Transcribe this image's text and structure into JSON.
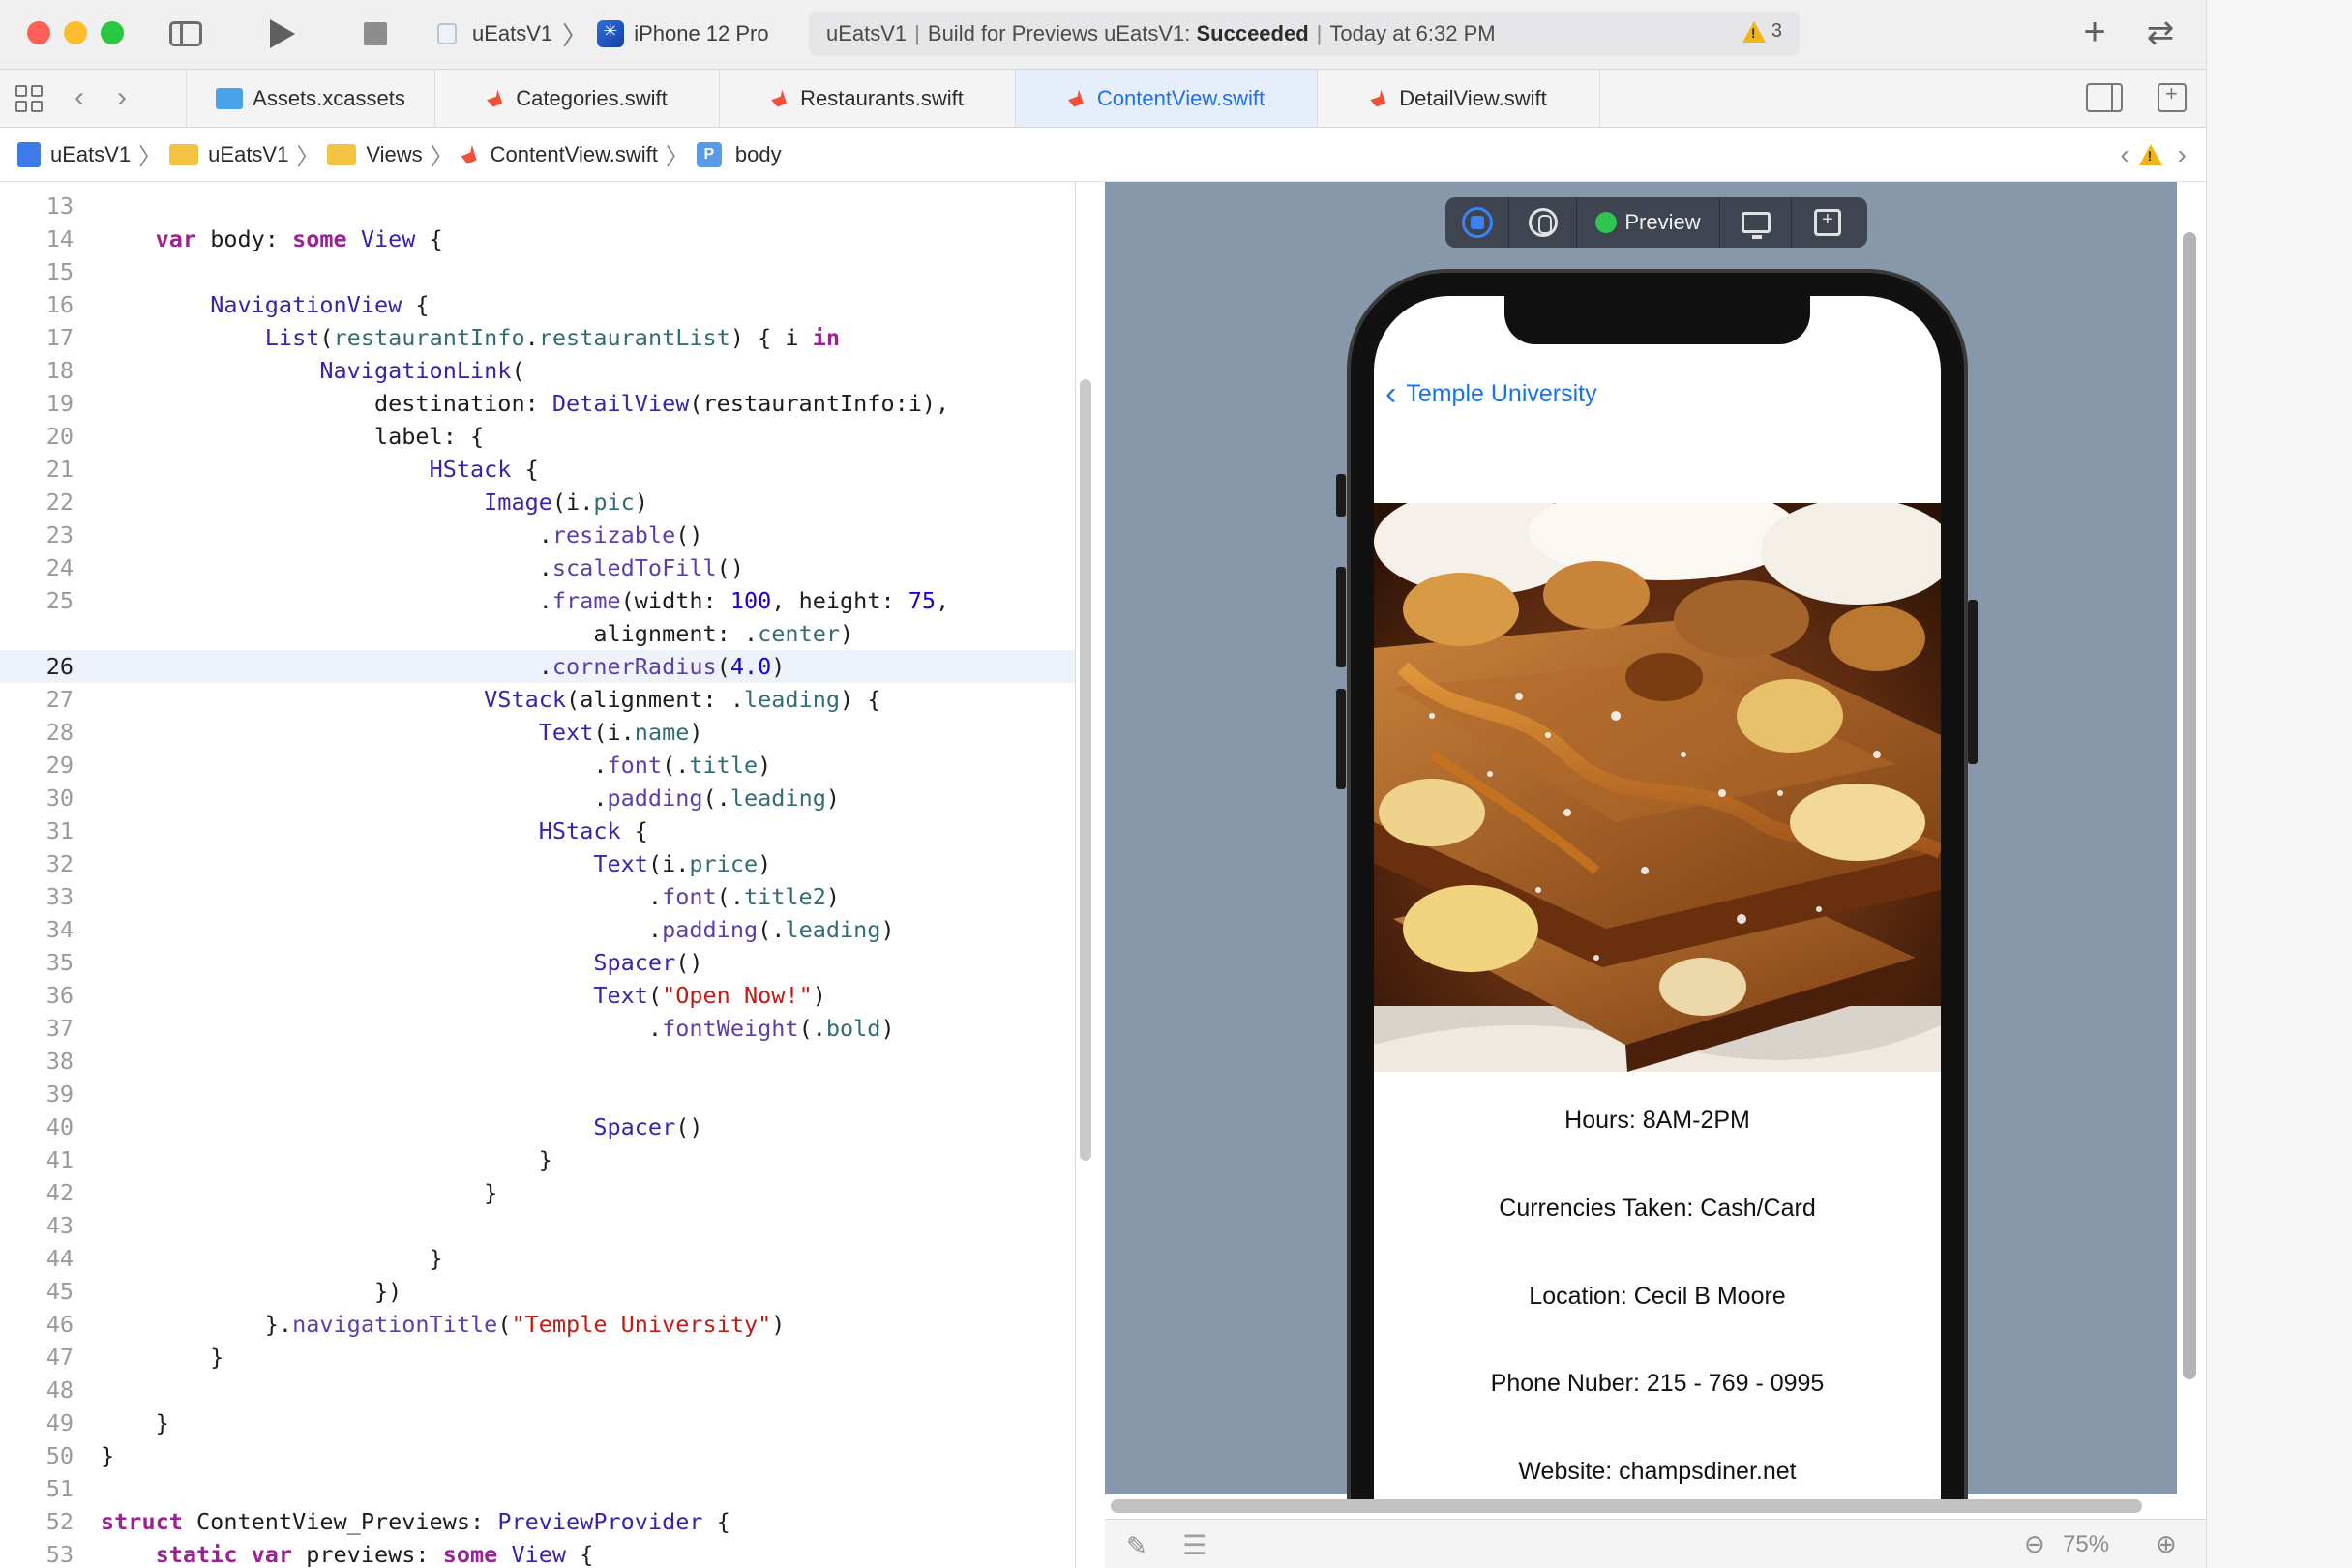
{
  "toolbar": {
    "scheme_name": "uEatsV1",
    "device_name": "iPhone 12 Pro",
    "activity": {
      "prefix": "uEatsV1",
      "build_text": "Build for Previews uEatsV1:",
      "build_status": "Succeeded",
      "timestamp": "Today at 6:32 PM",
      "warning_count": "3"
    },
    "add_label": "+",
    "swap_label": "⇄"
  },
  "tabs": [
    {
      "label": "Assets.xcassets",
      "active": false
    },
    {
      "label": "Categories.swift",
      "active": false
    },
    {
      "label": "Restaurants.swift",
      "active": false
    },
    {
      "label": "ContentView.swift",
      "active": true
    },
    {
      "label": "DetailView.swift",
      "active": false
    }
  ],
  "breadcrumb": {
    "project": "uEatsV1",
    "group": "uEatsV1",
    "folder": "Views",
    "file": "ContentView.swift",
    "symbol": "body",
    "symbol_badge": "P"
  },
  "editor": {
    "current_line": 26,
    "lines": [
      {
        "n": "13"
      },
      {
        "n": "14"
      },
      {
        "n": "15"
      },
      {
        "n": "16"
      },
      {
        "n": "17"
      },
      {
        "n": "18"
      },
      {
        "n": "19"
      },
      {
        "n": "20"
      },
      {
        "n": "21"
      },
      {
        "n": "22"
      },
      {
        "n": "23"
      },
      {
        "n": "24"
      },
      {
        "n": "25"
      },
      {
        "n": "26"
      },
      {
        "n": "27"
      },
      {
        "n": "28"
      },
      {
        "n": "29"
      },
      {
        "n": "30"
      },
      {
        "n": "31"
      },
      {
        "n": "32"
      },
      {
        "n": "33"
      },
      {
        "n": "34"
      },
      {
        "n": "35"
      },
      {
        "n": "36"
      },
      {
        "n": "37"
      },
      {
        "n": "38"
      },
      {
        "n": "39"
      },
      {
        "n": "40"
      },
      {
        "n": "41"
      },
      {
        "n": "42"
      },
      {
        "n": "43"
      },
      {
        "n": "44"
      },
      {
        "n": "45"
      },
      {
        "n": "46"
      },
      {
        "n": "47"
      },
      {
        "n": "48"
      },
      {
        "n": "49"
      },
      {
        "n": "50"
      },
      {
        "n": "51"
      },
      {
        "n": "52"
      },
      {
        "n": "53"
      }
    ],
    "code": {
      "l14": [
        "    ",
        "var",
        " body: ",
        "some",
        " ",
        "View",
        " {"
      ],
      "l16": [
        "        ",
        "NavigationView",
        " {"
      ],
      "l17": [
        "            ",
        "List",
        "(",
        "restaurantInfo",
        ".",
        "restaurantList",
        ") { i ",
        "in"
      ],
      "l18": [
        "                ",
        "NavigationLink",
        "("
      ],
      "l19": [
        "                    destination: ",
        "DetailView",
        "(restaurantInfo:i),"
      ],
      "l20": [
        "                    label: {"
      ],
      "l21": [
        "                        ",
        "HStack",
        " {"
      ],
      "l22": [
        "                            ",
        "Image",
        "(i.",
        "pic",
        ")"
      ],
      "l23": [
        "                                .",
        "resizable",
        "()"
      ],
      "l24": [
        "                                .",
        "scaledToFill",
        "()"
      ],
      "l25": [
        "                                .",
        "frame",
        "(width: ",
        "100",
        ", height: ",
        "75",
        ","
      ],
      "l25b": [
        "                                    alignment: .",
        "center",
        ")"
      ],
      "l26": [
        "                                .",
        "cornerRadius",
        "(",
        "4.0",
        ")"
      ],
      "l27": [
        "                            ",
        "VStack",
        "(alignment: .",
        "leading",
        ") {"
      ],
      "l28": [
        "                                ",
        "Text",
        "(i.",
        "name",
        ")"
      ],
      "l29": [
        "                                    .",
        "font",
        "(.",
        "title",
        ")"
      ],
      "l30": [
        "                                    .",
        "padding",
        "(.",
        "leading",
        ")"
      ],
      "l31": [
        "                                ",
        "HStack",
        " {"
      ],
      "l32": [
        "                                    ",
        "Text",
        "(i.",
        "price",
        ")"
      ],
      "l33": [
        "                                        .",
        "font",
        "(.",
        "title2",
        ")"
      ],
      "l34": [
        "                                        .",
        "padding",
        "(.",
        "leading",
        ")"
      ],
      "l35": [
        "                                    ",
        "Spacer",
        "()"
      ],
      "l36": [
        "                                    ",
        "Text",
        "(",
        "\"Open Now!\"",
        ")"
      ],
      "l37": [
        "                                        .",
        "fontWeight",
        "(.",
        "bold",
        ")"
      ],
      "l40": [
        "                                    ",
        "Spacer",
        "()"
      ],
      "l41": [
        "                                }"
      ],
      "l42": [
        "                            }"
      ],
      "l44": [
        "                        }"
      ],
      "l45": [
        "                    })"
      ],
      "l46": [
        "            }.",
        "navigationTitle",
        "(",
        "\"Temple University\"",
        ")"
      ],
      "l47": [
        "        }"
      ],
      "l49": [
        "    }"
      ],
      "l50": [
        "}"
      ],
      "l52": [
        "struct",
        " ContentView_Previews: ",
        "PreviewProvider",
        " {"
      ],
      "l53": [
        "    ",
        "static",
        " ",
        "var",
        " previews: ",
        "some",
        " ",
        "View",
        " {"
      ]
    }
  },
  "preview": {
    "toolbar_label": "Preview",
    "nav_back_title": "Temple University",
    "details": [
      "Hours: 8AM-2PM",
      "Currencies Taken: Cash/Card",
      "Location: Cecil B Moore",
      "Phone Nuber: 215 - 769 - 0995",
      "Website: champsdiner.net"
    ],
    "zoom": "75%"
  },
  "colors": {
    "accent": "#1a73e8",
    "canvas": "#8898ab",
    "warning": "#f3b512",
    "live_green": "#2fc551"
  }
}
